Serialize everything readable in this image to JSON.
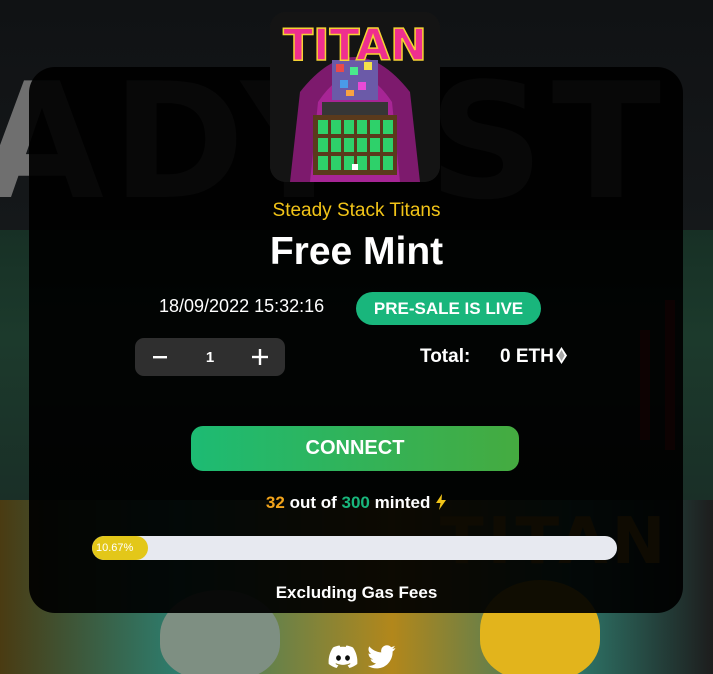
{
  "collection": {
    "name": "Steady Stack Titans"
  },
  "mint": {
    "title": "Free Mint",
    "timestamp": "18/09/2022 15:32:16",
    "status_badge": "PRE-SALE IS LIVE"
  },
  "quantity": {
    "minus_label": "−",
    "value": "1",
    "plus_label": "+"
  },
  "total": {
    "label": "Total:",
    "value": "0 ETH"
  },
  "connect_label": "CONNECT",
  "minted": {
    "count": "32",
    "text_out_of": "out of",
    "max": "300",
    "text_minted": "minted",
    "progress_label": "10.67%",
    "progress_fraction": 0.1067
  },
  "gas_note": "Excluding Gas Fees",
  "icons": {
    "eth": "ethereum-icon",
    "bolt": "lightning-icon",
    "discord": "discord-icon",
    "twitter": "twitter-icon"
  },
  "colors": {
    "accent_green": "#19b67c",
    "accent_yellow": "#f2c418",
    "accent_orange": "#f2a41b",
    "progress_fill": "#e3c719"
  }
}
